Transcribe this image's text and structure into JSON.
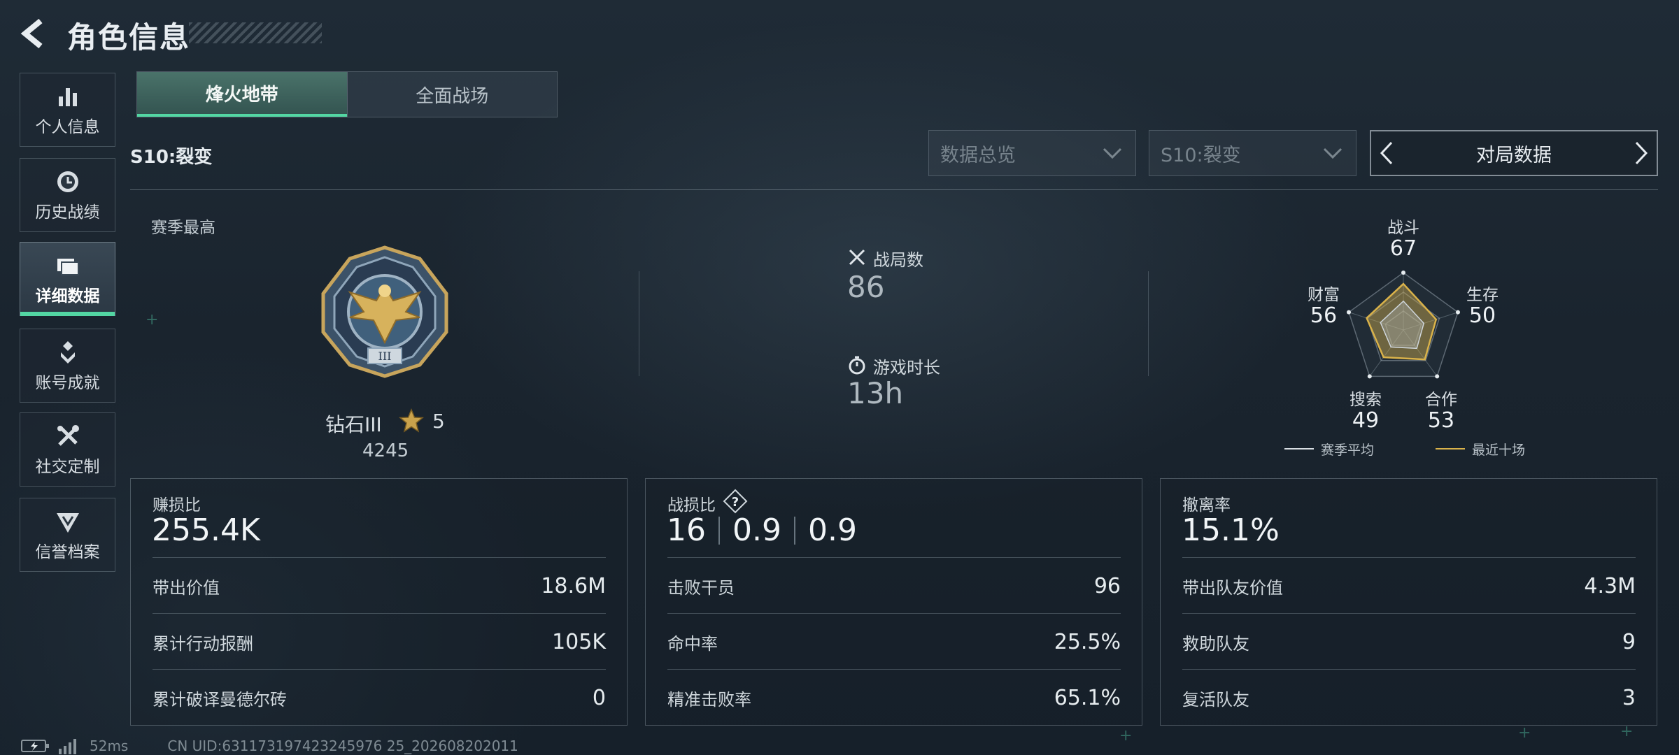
{
  "header": {
    "title": "角色信息"
  },
  "sidebar": {
    "items": [
      {
        "label": "个人信息",
        "icon": "bar-chart-icon"
      },
      {
        "label": "历史战绩",
        "icon": "clock-icon"
      },
      {
        "label": "详细数据",
        "icon": "folder-icon",
        "active": true
      },
      {
        "label": "账号成就",
        "icon": "achievement-icon"
      },
      {
        "label": "社交定制",
        "icon": "tools-icon"
      },
      {
        "label": "信誉档案",
        "icon": "badge-icon"
      }
    ]
  },
  "mode_tabs": {
    "active": "烽火地带",
    "inactive": "全面战场"
  },
  "season": {
    "label": "S10:裂变"
  },
  "filters": {
    "data_type": "数据总览",
    "season": "S10:裂变",
    "mode_selector": "对局数据"
  },
  "rank": {
    "season_high_label": "赛季最高",
    "name": "钻石III",
    "stars": "5",
    "score": "4245"
  },
  "stats": {
    "matches_label": "战局数",
    "matches_value": "86",
    "playtime_label": "游戏时长",
    "playtime_value": "13h"
  },
  "radar": {
    "axes": [
      {
        "label": "战斗",
        "value": "67"
      },
      {
        "label": "生存",
        "value": "50"
      },
      {
        "label": "合作",
        "value": "53"
      },
      {
        "label": "搜索",
        "value": "49"
      },
      {
        "label": "财富",
        "value": "56"
      }
    ],
    "legend": [
      {
        "label": "赛季平均",
        "color": "#d8dee3"
      },
      {
        "label": "最近十场",
        "color": "#d9b24a"
      }
    ],
    "recent_color": "#d9b24a"
  },
  "cards": {
    "profit": {
      "title": "赚损比",
      "value": "255.4K",
      "rows": [
        {
          "k": "带出价值",
          "v": "18.6M"
        },
        {
          "k": "累计行动报酬",
          "v": "105K"
        },
        {
          "k": "累计破译曼德尔砖",
          "v": "0"
        }
      ]
    },
    "combat": {
      "title": "战损比",
      "values": [
        "16",
        "0.9",
        "0.9"
      ],
      "rows": [
        {
          "k": "击败干员",
          "v": "96"
        },
        {
          "k": "命中率",
          "v": "25.5%"
        },
        {
          "k": "精准击败率",
          "v": "65.1%"
        }
      ]
    },
    "extract": {
      "title": "撤离率",
      "value": "15.1%",
      "rows": [
        {
          "k": "带出队友价值",
          "v": "4.3M"
        },
        {
          "k": "救助队友",
          "v": "9"
        },
        {
          "k": "复活队友",
          "v": "3"
        }
      ]
    }
  },
  "footer": {
    "ping": "52ms",
    "uid": "CN UID:631173197423245976 25_202608202011"
  }
}
